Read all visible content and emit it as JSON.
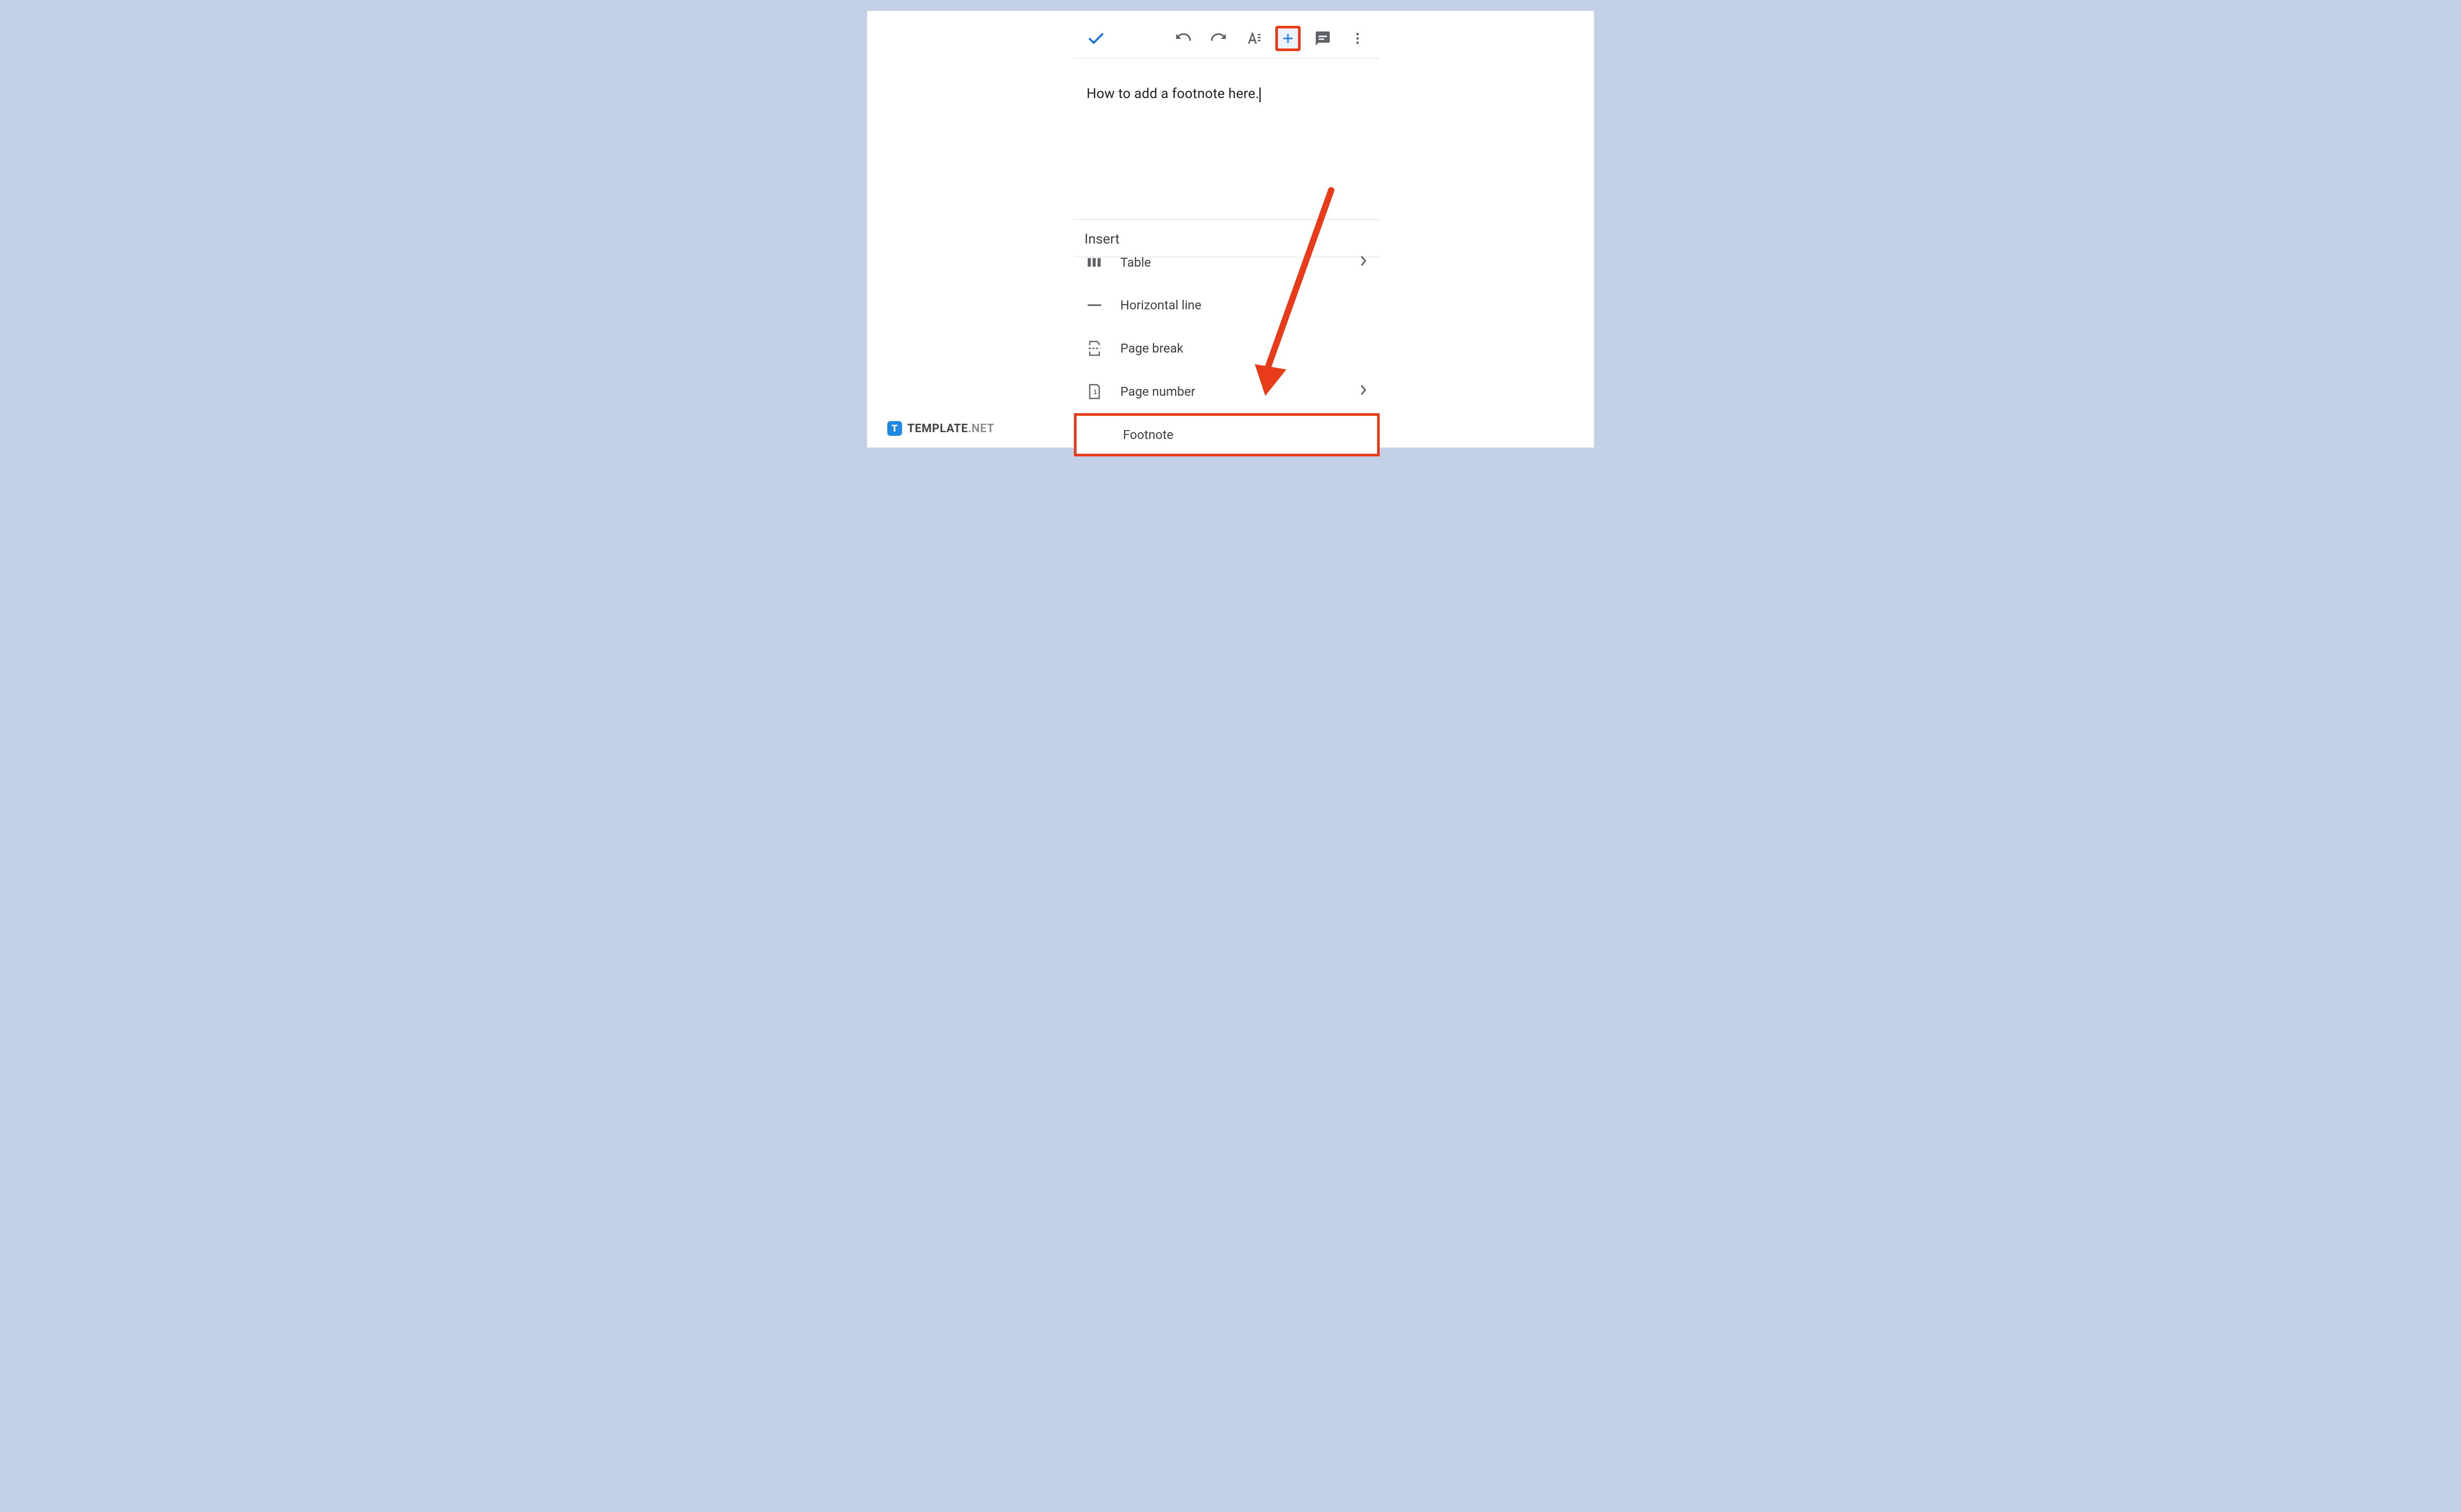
{
  "toolbar": {
    "done_label": "Done",
    "undo_label": "Undo",
    "redo_label": "Redo",
    "text_format_label": "Text format",
    "insert_label": "Insert",
    "comment_label": "Comment",
    "more_label": "More"
  },
  "document": {
    "body_text": "How to add a footnote here."
  },
  "insert_panel": {
    "title": "Insert",
    "items": [
      {
        "icon": "table-icon",
        "label": "Table",
        "has_submenu": true
      },
      {
        "icon": "horizontal-line-icon",
        "label": "Horizontal line",
        "has_submenu": false
      },
      {
        "icon": "page-break-icon",
        "label": "Page break",
        "has_submenu": false
      },
      {
        "icon": "page-number-icon",
        "label": "Page number",
        "has_submenu": true
      },
      {
        "icon": "footnote-icon",
        "label": "Footnote",
        "has_submenu": false
      }
    ]
  },
  "annotation": {
    "highlighted_toolbar_button": "insert-plus-button",
    "highlighted_menu_item": "Footnote",
    "arrow_color": "#e83b1a"
  },
  "watermark": {
    "brand": "TEMPLATE",
    "suffix": ".NET",
    "logo_letter": "T"
  }
}
